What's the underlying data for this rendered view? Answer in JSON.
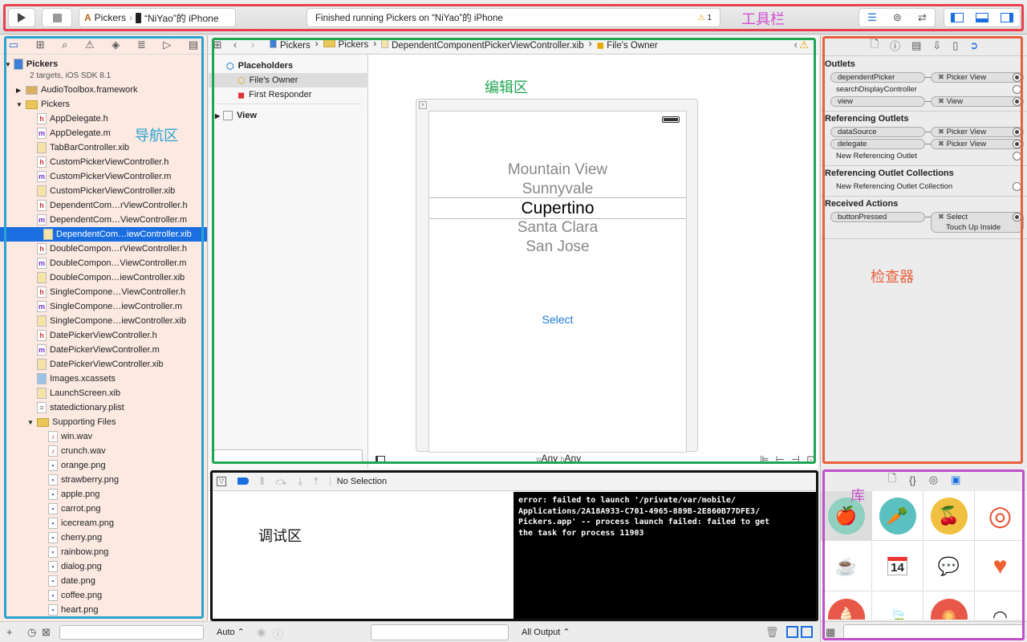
{
  "toolbar": {
    "scheme": "Pickers",
    "device": "“NiYao”的 iPhone",
    "status": "Finished running Pickers on “NiYao”的 iPhone",
    "warning_count": "1"
  },
  "annotations": {
    "toolbar": "工具栏",
    "navigator": "导航区",
    "editor": "编辑区",
    "inspector": "检查器",
    "debug": "调试区",
    "library": "库"
  },
  "colors": {
    "toolbar": "#e8404e",
    "navigator": "#2aa3d0",
    "editor": "#1fa552",
    "inspector": "#e8603c",
    "debug": "#111111",
    "library": "#c050c8",
    "selection": "#1a6ee0"
  },
  "navigator": {
    "project": {
      "name": "Pickers",
      "subtitle": "2 targets, iOS SDK 8.1"
    },
    "items": [
      {
        "label": "AudioToolbox.framework",
        "type": "framework",
        "level": 1,
        "disclosure": "closed"
      },
      {
        "label": "Pickers",
        "type": "folder",
        "level": 1,
        "disclosure": "open"
      },
      {
        "label": "AppDelegate.h",
        "type": "h",
        "level": 2
      },
      {
        "label": "AppDelegate.m",
        "type": "m",
        "level": 2
      },
      {
        "label": "TabBarController.xib",
        "type": "xib",
        "level": 2
      },
      {
        "label": "CustomPickerViewController.h",
        "type": "h",
        "level": 2
      },
      {
        "label": "CustomPickerViewController.m",
        "type": "m",
        "level": 2
      },
      {
        "label": "CustomPickerViewController.xib",
        "type": "xib",
        "level": 2
      },
      {
        "label": "DependentCom…rViewController.h",
        "type": "h",
        "level": 2
      },
      {
        "label": "DependentCom…ViewController.m",
        "type": "m",
        "level": 2
      },
      {
        "label": "DependentCom…iewController.xib",
        "type": "xib",
        "level": 2,
        "selected": true
      },
      {
        "label": "DoubleCompon…rViewController.h",
        "type": "h",
        "level": 2
      },
      {
        "label": "DoubleCompon…ViewController.m",
        "type": "m",
        "level": 2
      },
      {
        "label": "DoubleCompon…iewController.xib",
        "type": "xib",
        "level": 2
      },
      {
        "label": "SingleCompone…ViewController.h",
        "type": "h",
        "level": 2
      },
      {
        "label": "SingleCompone…iewController.m",
        "type": "m",
        "level": 2
      },
      {
        "label": "SingleCompone…iewController.xib",
        "type": "xib",
        "level": 2
      },
      {
        "label": "DatePickerViewController.h",
        "type": "h",
        "level": 2
      },
      {
        "label": "DatePickerViewController.m",
        "type": "m",
        "level": 2
      },
      {
        "label": "DatePickerViewController.xib",
        "type": "xib",
        "level": 2
      },
      {
        "label": "Images.xcassets",
        "type": "xcassets",
        "level": 2
      },
      {
        "label": "LaunchScreen.xib",
        "type": "xib",
        "level": 2
      },
      {
        "label": "statedictionary.plist",
        "type": "plist",
        "level": 2
      },
      {
        "label": "Supporting Files",
        "type": "folder",
        "level": 2,
        "disclosure": "open"
      },
      {
        "label": "win.wav",
        "type": "wav",
        "level": 3
      },
      {
        "label": "crunch.wav",
        "type": "wav",
        "level": 3
      },
      {
        "label": "orange.png",
        "type": "png",
        "level": 3
      },
      {
        "label": "strawberry.png",
        "type": "png",
        "level": 3
      },
      {
        "label": "apple.png",
        "type": "png",
        "level": 3
      },
      {
        "label": "carrot.png",
        "type": "png",
        "level": 3
      },
      {
        "label": "icecream.png",
        "type": "png",
        "level": 3
      },
      {
        "label": "cherry.png",
        "type": "png",
        "level": 3
      },
      {
        "label": "rainbow.png",
        "type": "png",
        "level": 3
      },
      {
        "label": "dialog.png",
        "type": "png",
        "level": 3
      },
      {
        "label": "date.png",
        "type": "png",
        "level": 3
      },
      {
        "label": "coffee.png",
        "type": "png",
        "level": 3
      },
      {
        "label": "heart.png",
        "type": "png",
        "level": 3
      }
    ]
  },
  "editor": {
    "breadcrumb": [
      "Pickers",
      "Pickers",
      "DependentComponentPickerViewController.xib",
      "File's Owner"
    ],
    "outline": {
      "placeholders": "Placeholders",
      "files_owner": "File's Owner",
      "first_responder": "First Responder",
      "view": "View"
    },
    "picker_rows": [
      "Mountain View",
      "Sunnyvale",
      "Cupertino",
      "Santa Clara",
      "San Jose"
    ],
    "button": "Select",
    "size_class": {
      "w": "w",
      "w_val": "Any",
      "h": "h",
      "h_val": "Any"
    }
  },
  "debug": {
    "selection": "No Selection",
    "console": "error: failed to launch '/private/var/mobile/\nApplications/2A18A933-C701-4965-889B-2E860B77DFE3/\nPickers.app' -- process launch failed: failed to get\nthe task for process 11903",
    "auto": "Auto ⌃",
    "output": "All Output ⌃"
  },
  "inspector": {
    "sections": [
      {
        "title": "Outlets",
        "rows": [
          {
            "name": "dependentPicker",
            "target": "Picker View",
            "connected": true
          },
          {
            "name": "searchDisplayController",
            "connected": false
          },
          {
            "name": "view",
            "target": "View",
            "connected": true
          }
        ]
      },
      {
        "title": "Referencing Outlets",
        "rows": [
          {
            "name": "dataSource",
            "target": "Picker View",
            "connected": true
          },
          {
            "name": "delegate",
            "target": "Picker View",
            "connected": true
          },
          {
            "name": "New Referencing Outlet",
            "connected": false
          }
        ]
      },
      {
        "title": "Referencing Outlet Collections",
        "rows": [
          {
            "name": "New Referencing Outlet Collection",
            "connected": false
          }
        ]
      },
      {
        "title": "Received Actions",
        "rows": [
          {
            "name": "buttonPressed",
            "target": "Select",
            "target_sub": "Touch Up Inside",
            "connected": true
          }
        ]
      }
    ]
  },
  "library": {
    "items": [
      "apple",
      "carrot",
      "cherry",
      "lifebuoy",
      "coffee",
      "calendar",
      "dialog",
      "heart",
      "icecream",
      "leaf",
      "orange",
      "rainbow"
    ],
    "calendar_day": "14"
  }
}
